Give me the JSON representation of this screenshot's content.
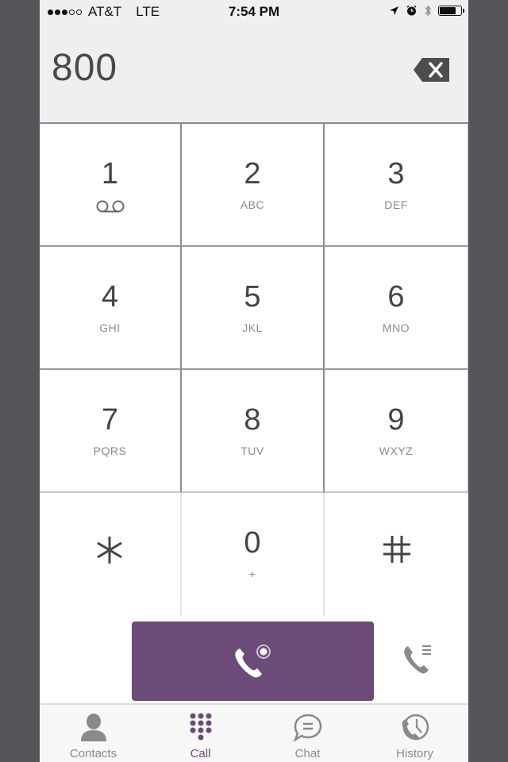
{
  "status_bar": {
    "signal_strength": "3 of 5",
    "carrier": "AT&T",
    "network": "LTE",
    "time": "7:54 PM",
    "icons": [
      "location-arrow-icon",
      "alarm-icon",
      "bluetooth-icon",
      "battery-icon"
    ],
    "battery_level": 0.8
  },
  "dialer": {
    "entered_number": "800",
    "backspace_icon": "backspace-icon"
  },
  "keypad": {
    "keys": [
      {
        "digit": "1",
        "letters": "",
        "icon": "voicemail-icon"
      },
      {
        "digit": "2",
        "letters": "ABC"
      },
      {
        "digit": "3",
        "letters": "DEF"
      },
      {
        "digit": "4",
        "letters": "GHI"
      },
      {
        "digit": "5",
        "letters": "JKL"
      },
      {
        "digit": "6",
        "letters": "MNO"
      },
      {
        "digit": "7",
        "letters": "PQRS"
      },
      {
        "digit": "8",
        "letters": "TUV"
      },
      {
        "digit": "9",
        "letters": "WXYZ"
      },
      {
        "digit": "*",
        "letters": ""
      },
      {
        "digit": "0",
        "letters": "+"
      },
      {
        "digit": "#",
        "letters": ""
      }
    ]
  },
  "actions": {
    "call_button_icon": "phone-call-icon",
    "call_list_icon": "phone-list-icon"
  },
  "tabbar": {
    "tabs": [
      {
        "label": "Contacts",
        "icon": "person-icon",
        "active": false
      },
      {
        "label": "Call",
        "icon": "keypad-icon",
        "active": true
      },
      {
        "label": "Chat",
        "icon": "chat-bubble-icon",
        "active": false
      },
      {
        "label": "History",
        "icon": "clock-phone-icon",
        "active": false
      }
    ]
  },
  "colors": {
    "accent": "#6d4b78",
    "inactive": "#8a8a8a",
    "background_frame": "#56555a"
  }
}
